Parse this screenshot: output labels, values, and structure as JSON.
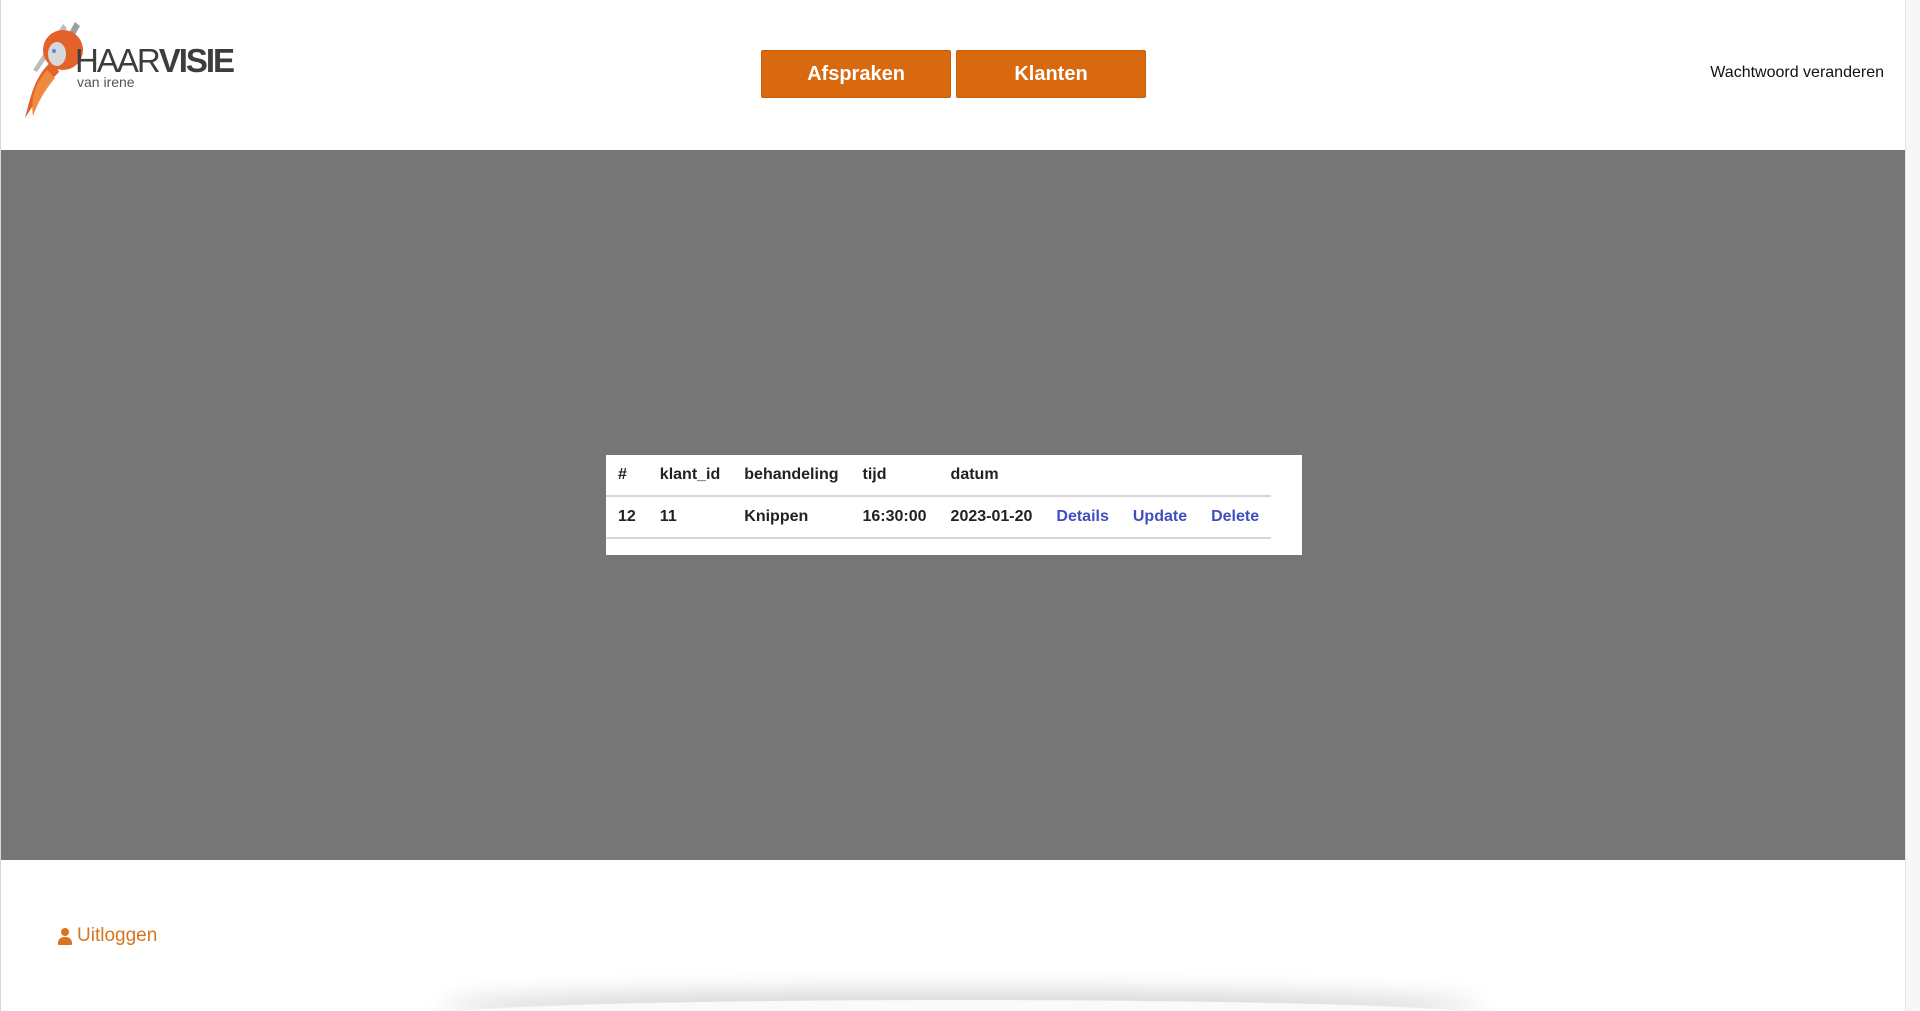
{
  "brand": {
    "logo_main_light": "HAAR",
    "logo_main_bold": "VISIE",
    "logo_sub": "van irene",
    "accent_color": "#d9690f"
  },
  "nav": {
    "afspraken_label": "Afspraken",
    "klanten_label": "Klanten",
    "change_password_label": "Wachtwoord veranderen"
  },
  "table": {
    "headers": [
      "#",
      "klant_id",
      "behandeling",
      "tijd",
      "datum"
    ],
    "rows": [
      {
        "id": "12",
        "klant_id": "11",
        "behandeling": "Knippen",
        "tijd": "16:30:00",
        "datum": "2023-01-20",
        "details_label": "Details",
        "update_label": "Update",
        "delete_label": "Delete"
      }
    ]
  },
  "footer": {
    "logout_icon": "user-icon",
    "logout_label": "Uitloggen"
  }
}
